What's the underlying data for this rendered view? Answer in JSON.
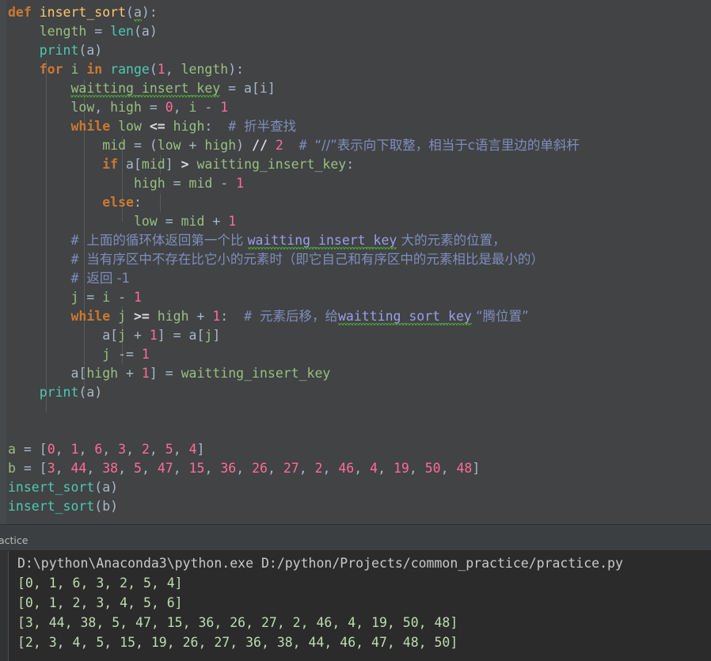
{
  "app": {
    "theme_name": "darcula",
    "editor_bg": "#414345",
    "console_bg": "#2b2b2b",
    "shell_bg": "#3c3f41"
  },
  "editor": {
    "language": "Python",
    "lines": [
      {
        "n": 1,
        "indent": 0,
        "tokens": [
          {
            "t": "def ",
            "c": "kw"
          },
          {
            "t": "insert_sort",
            "c": "fn"
          },
          {
            "t": "(",
            "c": "op"
          },
          {
            "t": "a",
            "c": "param",
            "squig": true
          },
          {
            "t": "):",
            "c": "op"
          }
        ]
      },
      {
        "n": 2,
        "indent": 1,
        "tokens": [
          {
            "t": "length",
            "c": "var"
          },
          {
            "t": " = ",
            "c": "op"
          },
          {
            "t": "len",
            "c": "call"
          },
          {
            "t": "(a)",
            "c": "op"
          }
        ]
      },
      {
        "n": 3,
        "indent": 1,
        "tokens": [
          {
            "t": "print",
            "c": "call"
          },
          {
            "t": "(a)",
            "c": "op"
          }
        ]
      },
      {
        "n": 4,
        "indent": 1,
        "tokens": [
          {
            "t": "for ",
            "c": "kw"
          },
          {
            "t": "i",
            "c": "var"
          },
          {
            "t": " ",
            "c": "op"
          },
          {
            "t": "in ",
            "c": "kw"
          },
          {
            "t": "range",
            "c": "call"
          },
          {
            "t": "(",
            "c": "op"
          },
          {
            "t": "1",
            "c": "num"
          },
          {
            "t": ", ",
            "c": "op"
          },
          {
            "t": "length",
            "c": "var"
          },
          {
            "t": "):",
            "c": "op"
          }
        ]
      },
      {
        "n": 5,
        "indent": 2,
        "tokens": [
          {
            "t": "waitting_insert_key",
            "c": "var",
            "squig": true
          },
          {
            "t": " = a[i]",
            "c": "op"
          }
        ]
      },
      {
        "n": 6,
        "indent": 2,
        "tokens": [
          {
            "t": "low",
            "c": "var"
          },
          {
            "t": ", ",
            "c": "op"
          },
          {
            "t": "high",
            "c": "var"
          },
          {
            "t": " = ",
            "c": "op"
          },
          {
            "t": "0",
            "c": "num"
          },
          {
            "t": ", ",
            "c": "op"
          },
          {
            "t": "i",
            "c": "var"
          },
          {
            "t": " - ",
            "c": "op"
          },
          {
            "t": "1",
            "c": "num"
          }
        ]
      },
      {
        "n": 7,
        "indent": 2,
        "tokens": [
          {
            "t": "while ",
            "c": "kw"
          },
          {
            "t": "low",
            "c": "var"
          },
          {
            "t": " ",
            "c": "op"
          },
          {
            "t": "<=",
            "c": "opb"
          },
          {
            "t": " ",
            "c": "op"
          },
          {
            "t": "high",
            "c": "var"
          },
          {
            "t": ":  ",
            "c": "op"
          },
          {
            "t": "# ",
            "c": "cmt"
          },
          {
            "t": "折半查找",
            "c": "cmt",
            "cn": true
          }
        ]
      },
      {
        "n": 8,
        "indent": 3,
        "tokens": [
          {
            "t": "mid",
            "c": "var"
          },
          {
            "t": " = (",
            "c": "op"
          },
          {
            "t": "low",
            "c": "var"
          },
          {
            "t": " + ",
            "c": "op"
          },
          {
            "t": "high",
            "c": "var"
          },
          {
            "t": ") ",
            "c": "op"
          },
          {
            "t": "//",
            "c": "opb"
          },
          {
            "t": " ",
            "c": "op"
          },
          {
            "t": "2",
            "c": "num"
          },
          {
            "t": "  ",
            "c": "op"
          },
          {
            "t": "# ",
            "c": "cmt"
          },
          {
            "t": "“//”表示向下取整，相当于c语言里边的单斜杆",
            "c": "cmt",
            "cn": true
          }
        ]
      },
      {
        "n": 9,
        "indent": 3,
        "tokens": [
          {
            "t": "if ",
            "c": "kw"
          },
          {
            "t": "a[",
            "c": "op"
          },
          {
            "t": "mid",
            "c": "var"
          },
          {
            "t": "] ",
            "c": "op"
          },
          {
            "t": ">",
            "c": "opb"
          },
          {
            "t": " ",
            "c": "op"
          },
          {
            "t": "waitting_insert_key",
            "c": "var"
          },
          {
            "t": ":",
            "c": "op"
          }
        ]
      },
      {
        "n": 10,
        "indent": 4,
        "tokens": [
          {
            "t": "high",
            "c": "var"
          },
          {
            "t": " = ",
            "c": "op"
          },
          {
            "t": "mid",
            "c": "var"
          },
          {
            "t": " - ",
            "c": "op"
          },
          {
            "t": "1",
            "c": "num"
          }
        ]
      },
      {
        "n": 11,
        "indent": 3,
        "tokens": [
          {
            "t": "else",
            "c": "kw"
          },
          {
            "t": ":",
            "c": "op"
          }
        ]
      },
      {
        "n": 12,
        "indent": 4,
        "tokens": [
          {
            "t": "low",
            "c": "var"
          },
          {
            "t": " = ",
            "c": "op"
          },
          {
            "t": "mid",
            "c": "var"
          },
          {
            "t": " + ",
            "c": "op"
          },
          {
            "t": "1",
            "c": "num"
          }
        ]
      },
      {
        "n": 13,
        "indent": 2,
        "tokens": [
          {
            "t": "# ",
            "c": "cmt"
          },
          {
            "t": "上面的循环体返回第一个比 ",
            "c": "cmt",
            "cn": true
          },
          {
            "t": "waitting_insert_key",
            "c": "cmtid",
            "squig": true
          },
          {
            "t": " 大的元素的位置，",
            "c": "cmt",
            "cn": true
          }
        ]
      },
      {
        "n": 14,
        "indent": 2,
        "tokens": [
          {
            "t": "# ",
            "c": "cmt"
          },
          {
            "t": "当有序区中不存在比它小的元素时（即它自己和有序区中的元素相比是最小的）",
            "c": "cmt",
            "cn": true
          }
        ]
      },
      {
        "n": 15,
        "indent": 2,
        "tokens": [
          {
            "t": "# ",
            "c": "cmt"
          },
          {
            "t": "返回 -1",
            "c": "cmt",
            "cn": true
          }
        ]
      },
      {
        "n": 16,
        "indent": 2,
        "tokens": [
          {
            "t": "j",
            "c": "var"
          },
          {
            "t": " = ",
            "c": "op"
          },
          {
            "t": "i",
            "c": "var"
          },
          {
            "t": " - ",
            "c": "op"
          },
          {
            "t": "1",
            "c": "num"
          }
        ]
      },
      {
        "n": 17,
        "indent": 2,
        "tokens": [
          {
            "t": "while ",
            "c": "kw"
          },
          {
            "t": "j",
            "c": "var"
          },
          {
            "t": " ",
            "c": "op"
          },
          {
            "t": ">=",
            "c": "opb"
          },
          {
            "t": " ",
            "c": "op"
          },
          {
            "t": "high",
            "c": "var"
          },
          {
            "t": " + ",
            "c": "op"
          },
          {
            "t": "1",
            "c": "num"
          },
          {
            "t": ":  ",
            "c": "op"
          },
          {
            "t": "# ",
            "c": "cmt"
          },
          {
            "t": "元素后移，给",
            "c": "cmt",
            "cn": true
          },
          {
            "t": "waitting_sort_key",
            "c": "cmtid",
            "squig": true
          },
          {
            "t": " “腾位置”",
            "c": "cmt",
            "cn": true
          }
        ]
      },
      {
        "n": 18,
        "indent": 3,
        "tokens": [
          {
            "t": "a[",
            "c": "op"
          },
          {
            "t": "j",
            "c": "var"
          },
          {
            "t": " + ",
            "c": "op"
          },
          {
            "t": "1",
            "c": "num"
          },
          {
            "t": "] = a[",
            "c": "op"
          },
          {
            "t": "j",
            "c": "var"
          },
          {
            "t": "]",
            "c": "op"
          }
        ]
      },
      {
        "n": 19,
        "indent": 3,
        "tokens": [
          {
            "t": "j",
            "c": "var"
          },
          {
            "t": " ",
            "c": "op"
          },
          {
            "t": "-=",
            "c": "op"
          },
          {
            "t": " ",
            "c": "op"
          },
          {
            "t": "1",
            "c": "num"
          }
        ]
      },
      {
        "n": 20,
        "indent": 2,
        "tokens": [
          {
            "t": "a[",
            "c": "op"
          },
          {
            "t": "high",
            "c": "var"
          },
          {
            "t": " + ",
            "c": "op"
          },
          {
            "t": "1",
            "c": "num"
          },
          {
            "t": "] = ",
            "c": "op"
          },
          {
            "t": "waitting_insert_key",
            "c": "var"
          }
        ]
      },
      {
        "n": 21,
        "indent": 1,
        "tokens": [
          {
            "t": "print",
            "c": "call"
          },
          {
            "t": "(a)",
            "c": "op"
          }
        ]
      },
      {
        "n": 22,
        "indent": 0,
        "tokens": []
      },
      {
        "n": 23,
        "indent": 0,
        "tokens": []
      },
      {
        "n": 24,
        "indent": 0,
        "tokens": [
          {
            "t": "a",
            "c": "var"
          },
          {
            "t": " = [",
            "c": "op"
          },
          {
            "t": "0",
            "c": "num"
          },
          {
            "t": ", ",
            "c": "op"
          },
          {
            "t": "1",
            "c": "num"
          },
          {
            "t": ", ",
            "c": "op"
          },
          {
            "t": "6",
            "c": "num"
          },
          {
            "t": ", ",
            "c": "op"
          },
          {
            "t": "3",
            "c": "num"
          },
          {
            "t": ", ",
            "c": "op"
          },
          {
            "t": "2",
            "c": "num"
          },
          {
            "t": ", ",
            "c": "op"
          },
          {
            "t": "5",
            "c": "num"
          },
          {
            "t": ", ",
            "c": "op"
          },
          {
            "t": "4",
            "c": "num"
          },
          {
            "t": "]",
            "c": "op"
          }
        ]
      },
      {
        "n": 25,
        "indent": 0,
        "tokens": [
          {
            "t": "b",
            "c": "var"
          },
          {
            "t": " = [",
            "c": "op"
          },
          {
            "t": "3",
            "c": "num"
          },
          {
            "t": ", ",
            "c": "op"
          },
          {
            "t": "44",
            "c": "num"
          },
          {
            "t": ", ",
            "c": "op"
          },
          {
            "t": "38",
            "c": "num"
          },
          {
            "t": ", ",
            "c": "op"
          },
          {
            "t": "5",
            "c": "num"
          },
          {
            "t": ", ",
            "c": "op"
          },
          {
            "t": "47",
            "c": "num"
          },
          {
            "t": ", ",
            "c": "op"
          },
          {
            "t": "15",
            "c": "num"
          },
          {
            "t": ", ",
            "c": "op"
          },
          {
            "t": "36",
            "c": "num"
          },
          {
            "t": ", ",
            "c": "op"
          },
          {
            "t": "26",
            "c": "num"
          },
          {
            "t": ", ",
            "c": "op"
          },
          {
            "t": "27",
            "c": "num"
          },
          {
            "t": ", ",
            "c": "op"
          },
          {
            "t": "2",
            "c": "num"
          },
          {
            "t": ", ",
            "c": "op"
          },
          {
            "t": "46",
            "c": "num"
          },
          {
            "t": ", ",
            "c": "op"
          },
          {
            "t": "4",
            "c": "num"
          },
          {
            "t": ", ",
            "c": "op"
          },
          {
            "t": "19",
            "c": "num"
          },
          {
            "t": ", ",
            "c": "op"
          },
          {
            "t": "50",
            "c": "num"
          },
          {
            "t": ", ",
            "c": "op"
          },
          {
            "t": "48",
            "c": "num"
          },
          {
            "t": "]",
            "c": "op"
          }
        ]
      },
      {
        "n": 26,
        "indent": 0,
        "tokens": [
          {
            "t": "insert_sort",
            "c": "call"
          },
          {
            "t": "(a)",
            "c": "op"
          }
        ]
      },
      {
        "n": 27,
        "indent": 0,
        "tokens": [
          {
            "t": "insert_sort",
            "c": "call"
          },
          {
            "t": "(b)",
            "c": "op"
          }
        ]
      }
    ]
  },
  "console": {
    "tab_label": "actice",
    "lines": [
      {
        "text": "D:\\python\\Anaconda3\\python.exe D:/python/Projects/common_practice/practice.py",
        "kind": "out-cmd"
      },
      {
        "text": "[0, 1, 6, 3, 2, 5, 4]",
        "kind": "out-std"
      },
      {
        "text": "[0, 1, 2, 3, 4, 5, 6]",
        "kind": "out-std"
      },
      {
        "text": "[3, 44, 38, 5, 47, 15, 36, 26, 27, 2, 46, 4, 19, 50, 48]",
        "kind": "out-std"
      },
      {
        "text": "[2, 3, 4, 5, 15, 19, 26, 27, 36, 38, 44, 46, 47, 48, 50]",
        "kind": "out-std"
      }
    ]
  }
}
